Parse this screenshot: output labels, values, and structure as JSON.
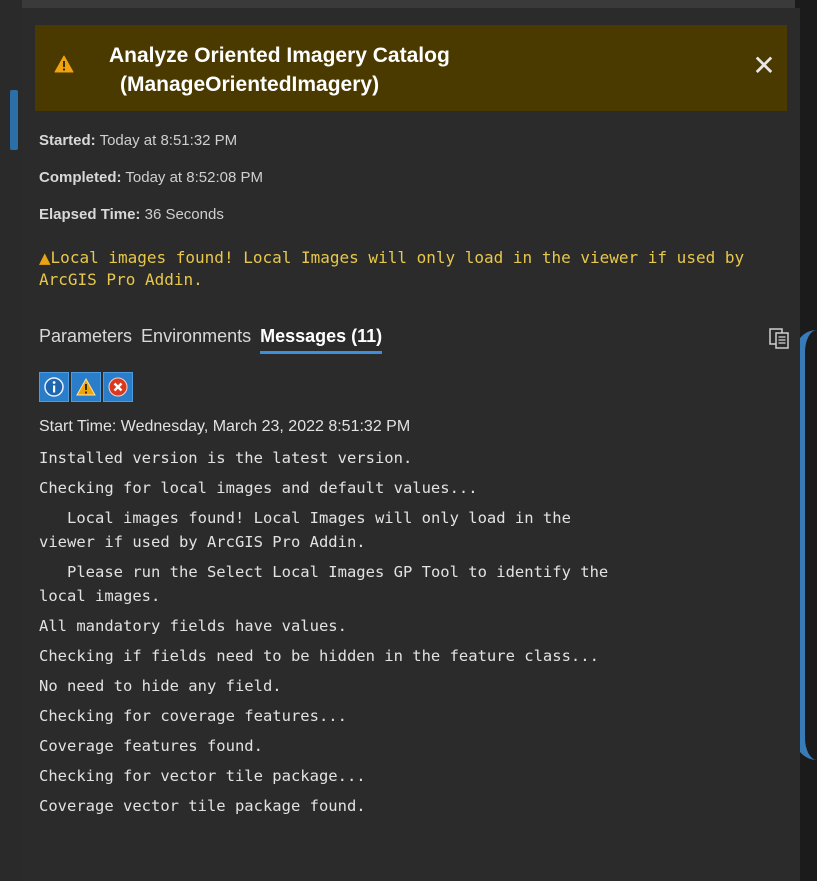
{
  "header": {
    "title_line1": "Analyze Oriented Imagery Catalog",
    "title_line2": "(ManageOrientedImagery)",
    "close_label": "✕"
  },
  "info": {
    "started_label": "Started:",
    "started_value": " Today at 8:51:32 PM",
    "completed_label": "Completed:",
    "completed_value": " Today at 8:52:08 PM",
    "elapsed_label": "Elapsed Time:",
    "elapsed_value": " 36 Seconds"
  },
  "warning_banner": {
    "icon": "warning-icon",
    "text": "Local images found! Local Images will only load in the viewer if used by ArcGIS Pro Addin."
  },
  "tabs": [
    {
      "label": "Parameters"
    },
    {
      "label": "Environments"
    },
    {
      "label": "Messages (11)"
    }
  ],
  "active_tab": "Messages (11)",
  "filters": [
    {
      "icon": "info-icon"
    },
    {
      "icon": "warning-icon"
    },
    {
      "icon": "error-icon"
    }
  ],
  "messages": [
    "Start Time: Wednesday, March 23, 2022 8:51:32 PM",
    "Installed version is the latest version.",
    "Checking for local images and default values...",
    "   Local images found! Local Images will only load in the\nviewer if used by ArcGIS Pro Addin.",
    "   Please run the Select Local Images GP Tool to identify the\nlocal images.",
    "All mandatory fields have values.",
    "Checking if fields need to be hidden in the feature class...",
    "No need to hide any field.",
    "Checking for coverage features...",
    "Coverage features found.",
    "Checking for vector tile package...",
    "Coverage vector tile package found."
  ],
  "colors": {
    "header_bg": "#4a3a00",
    "panel_bg": "#2b2b2b",
    "accent": "#3d8fdc",
    "warning_text": "#e8c84a",
    "warning_icon": "#e8a317"
  }
}
